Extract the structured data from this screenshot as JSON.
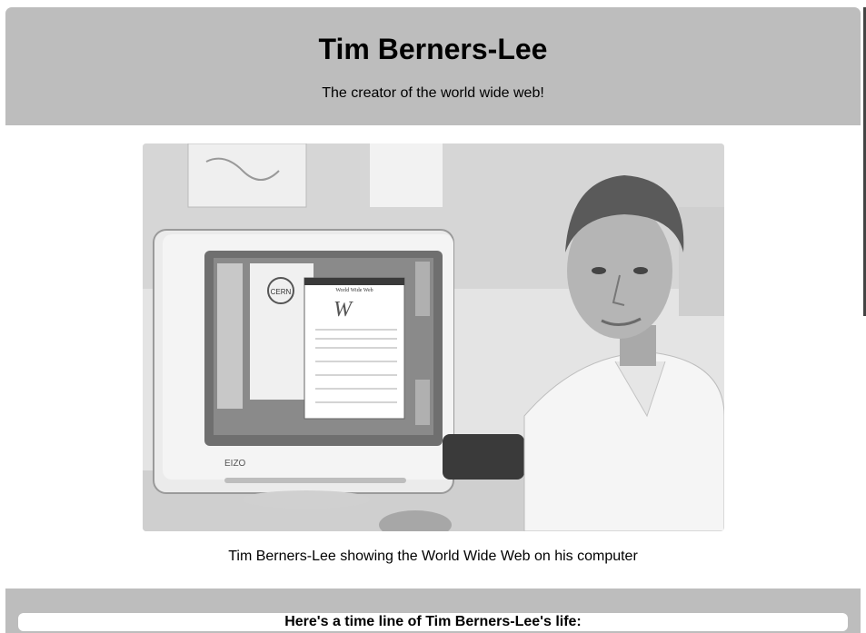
{
  "header": {
    "title": "Tim Berners-Lee",
    "subtitle": "The creator of the world wide web!"
  },
  "figure": {
    "image_alt": "Tim Berners-Lee at his computer",
    "caption": "Tim Berners-Lee showing the World Wide Web on his computer",
    "screen_text": {
      "cern": "CERN",
      "web_title": "World Wide Web",
      "monitor_brand": "EIZO"
    }
  },
  "timeline": {
    "heading": "Here's a time line of Tim Berners-Lee's life:"
  }
}
